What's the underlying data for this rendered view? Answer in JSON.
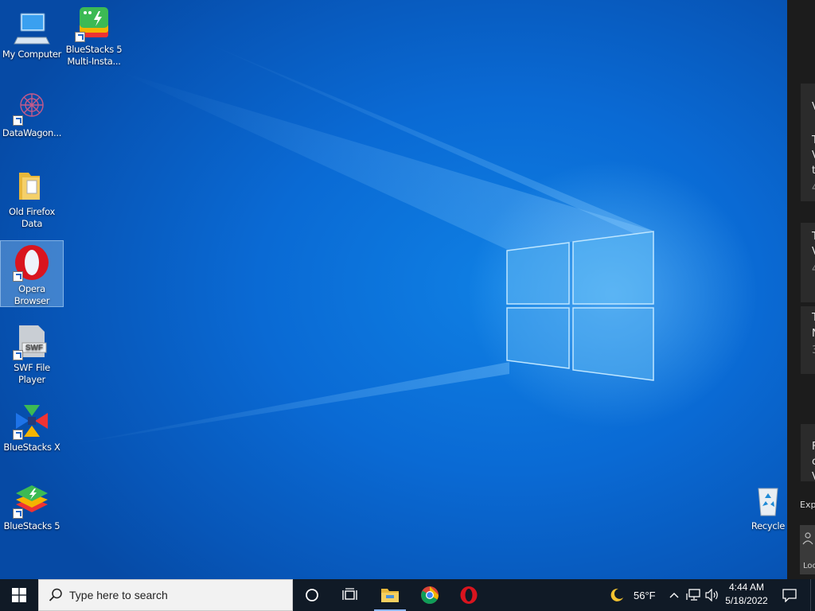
{
  "desktop": {
    "icons": [
      {
        "label": "My Computer",
        "icon": "computer-icon"
      },
      {
        "label": "BlueStacks 5 Multi-Insta...",
        "icon": "bluestacks-multi-instance-icon"
      },
      {
        "label": "DataWagon...",
        "icon": "datawagon-icon"
      },
      {
        "label": "Old Firefox Data",
        "icon": "folder-icon"
      },
      {
        "label": "Opera Browser",
        "icon": "opera-icon"
      },
      {
        "label": "SWF File Player",
        "icon": "swf-player-icon"
      },
      {
        "label": "BlueStacks X",
        "icon": "bluestacks-x-icon"
      },
      {
        "label": "BlueStacks 5",
        "icon": "bluestacks-icon"
      },
      {
        "label": "Recycle",
        "icon": "recycle-bin-icon"
      }
    ],
    "selected_icon": "Opera Browser"
  },
  "edge_panel": {
    "items": [
      "V",
      "T",
      "V",
      "t",
      "4",
      "T",
      "V",
      "4",
      "T",
      "N",
      "3",
      "F",
      "c",
      "V"
    ],
    "expand_label": "Exp",
    "lock_label": "Loc"
  },
  "taskbar": {
    "start_icon": "windows-logo-icon",
    "search_placeholder": "Type here to search",
    "pinned": [
      "cortana-icon",
      "task-view-icon",
      "file-explorer-icon",
      "chrome-icon",
      "opera-icon"
    ],
    "weather": {
      "temp": "56°F",
      "icon": "moon-icon"
    },
    "tray_icons": [
      "chevron-up-icon",
      "network-icon",
      "volume-icon"
    ],
    "time": "4:44 AM",
    "date": "5/18/2022",
    "notification_icon": "notification-icon"
  },
  "colors": {
    "taskbar": "#101a26",
    "desktop_accent": "#0a6ad4",
    "opera_red": "#d9141e"
  }
}
